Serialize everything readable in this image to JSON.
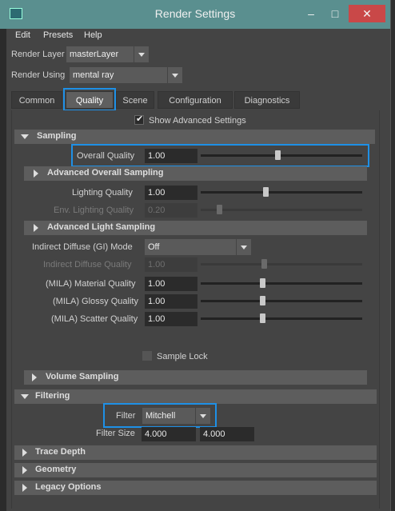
{
  "window": {
    "title": "Render Settings",
    "controls": {
      "minimize": "–",
      "maximize": "□",
      "close": "✕"
    }
  },
  "menu": [
    "Edit",
    "Presets",
    "Help"
  ],
  "render_layer": {
    "label": "Render Layer",
    "value": "masterLayer"
  },
  "render_using": {
    "label": "Render Using",
    "value": "mental ray"
  },
  "tabs": [
    "Common",
    "Quality",
    "Scene",
    "Configuration",
    "Diagnostics"
  ],
  "active_tab": "Quality",
  "show_advanced": {
    "label": "Show Advanced Settings",
    "checked": true
  },
  "sampling": {
    "title": "Sampling",
    "overall_quality": {
      "label": "Overall Quality",
      "value": "1.00",
      "slider": 0.5
    },
    "advanced_overall": "Advanced Overall Sampling",
    "lighting_quality": {
      "label": "Lighting Quality",
      "value": "1.00",
      "slider": 0.4
    },
    "env_lighting_quality": {
      "label": "Env. Lighting Quality",
      "value": "0.20",
      "slider": 0.1
    },
    "advanced_light": "Advanced Light Sampling",
    "indirect_mode": {
      "label": "Indirect Diffuse (GI) Mode",
      "value": "Off"
    },
    "indirect_quality": {
      "label": "Indirect Diffuse Quality",
      "value": "1.00",
      "slider": 0.4
    },
    "material_quality": {
      "label": "(MILA) Material Quality",
      "value": "1.00",
      "slider": 0.4
    },
    "glossy_quality": {
      "label": "(MILA) Glossy Quality",
      "value": "1.00",
      "slider": 0.4
    },
    "scatter_quality": {
      "label": "(MILA) Scatter Quality",
      "value": "1.00",
      "slider": 0.4
    },
    "sample_lock": {
      "label": "Sample Lock",
      "checked": false
    }
  },
  "volume_sampling": "Volume Sampling",
  "filtering": {
    "title": "Filtering",
    "filter": {
      "label": "Filter",
      "value": "Mitchell"
    },
    "filter_size": {
      "label": "Filter Size",
      "x": "4.000",
      "y": "4.000"
    }
  },
  "collapsed_sections": [
    "Trace Depth",
    "Geometry",
    "Legacy Options"
  ],
  "colors": {
    "highlight": "#1e90e6",
    "titlebar": "#5a8f8f",
    "close": "#c94848"
  }
}
